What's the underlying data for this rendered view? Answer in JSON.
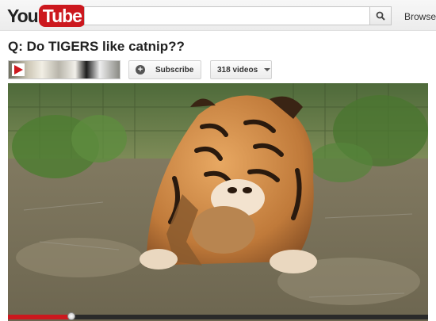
{
  "brand": {
    "logo_you": "You",
    "logo_tube": "Tube",
    "accent": "#cc181e"
  },
  "search": {
    "query": "",
    "placeholder": ""
  },
  "header": {
    "browse_label": "Browse"
  },
  "video": {
    "title": "Q: Do TIGERS like catnip??",
    "playback_progress": 0.15
  },
  "channel": {
    "subscribe_label": "Subscribe",
    "videos_label": "318 videos"
  },
  "icons": [
    "search-icon",
    "play-icon",
    "plus-icon",
    "chevron-down-icon"
  ]
}
